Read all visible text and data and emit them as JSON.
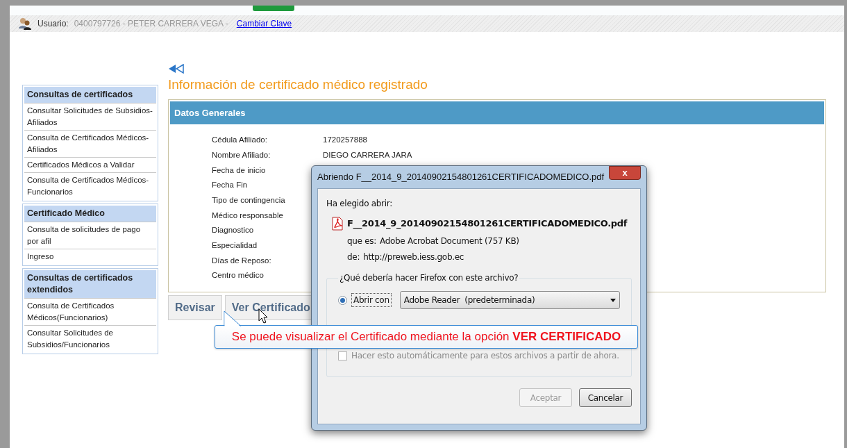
{
  "user_bar": {
    "label": "Usuario:",
    "user": "0400797726 - PETER CARRERA VEGA -",
    "link": "Cambiar Clave"
  },
  "sidebar": {
    "sections": [
      {
        "title": "Consultas de certificados",
        "items": [
          {
            "label": "Consultar Solicitudes de Subsidios-Afiliados"
          },
          {
            "label": "Consulta de Certificados Médicos-Afiliados"
          },
          {
            "label": "Certificados Médicos a Validar"
          },
          {
            "label": "Consulta de Certificados Médicos-Funcionarios"
          }
        ]
      },
      {
        "title": "Certificado Médico",
        "items": [
          {
            "label": "Consulta de solicitudes de pago por afil"
          },
          {
            "label": "Ingreso"
          }
        ]
      },
      {
        "title": "Consultas de certificados extendidos",
        "items": [
          {
            "label": "Consulta de Certificados Médicos(Funcionarios)"
          },
          {
            "label": "Consultar Solicitudes de Subsidios/Funcionarios"
          }
        ]
      }
    ]
  },
  "main": {
    "title": "Información de certificado médico registrado",
    "panel_title": "Datos Generales",
    "fields": [
      {
        "label": "Cédula Afiliado:",
        "value": "1720257888"
      },
      {
        "label": "Nombre Afiliado:",
        "value": "DIEGO CARRERA JARA"
      },
      {
        "label": "Fecha de inicio"
      },
      {
        "label": "Fecha Fin"
      },
      {
        "label": "Tipo de contingencia"
      },
      {
        "label": "Médico responsable"
      },
      {
        "label": "Diagnostico"
      },
      {
        "label": "Especialidad"
      },
      {
        "label": "Días de Reposo:"
      },
      {
        "label": "Centro médico"
      }
    ],
    "buttons": [
      "Revisar",
      "Ver Certificado"
    ]
  },
  "dialog": {
    "title": "Abriendo F__2014_9_20140902154801261CERTIFICADOMEDICO.pdf",
    "close": "x",
    "intro": "Ha elegido abrir:",
    "file_name": "F__2014_9_20140902154801261CERTIFICADOMEDICO.pdf",
    "type_label": "que es:",
    "type_value": "Adobe Acrobat Document (757 KB)",
    "from_label": "de:",
    "from_value": "http://preweb.iess.gob.ec",
    "question": "¿Qué debería hacer Firefox con este archivo?",
    "open_with": {
      "label": "Abrir con",
      "selected": true,
      "app": "Adobe Reader  (predeterminada)"
    },
    "auto": {
      "label": "Hacer esto automáticamente para estos archivos a partir de ahora.",
      "checked": false,
      "disabled": true
    },
    "buttons": [
      {
        "label": "Aceptar",
        "disabled": true
      },
      {
        "label": "Cancelar",
        "disabled": false
      }
    ]
  },
  "callout": "Se puede visualizar el Certificado  mediante la opción **VER CERTIFICADO**"
}
